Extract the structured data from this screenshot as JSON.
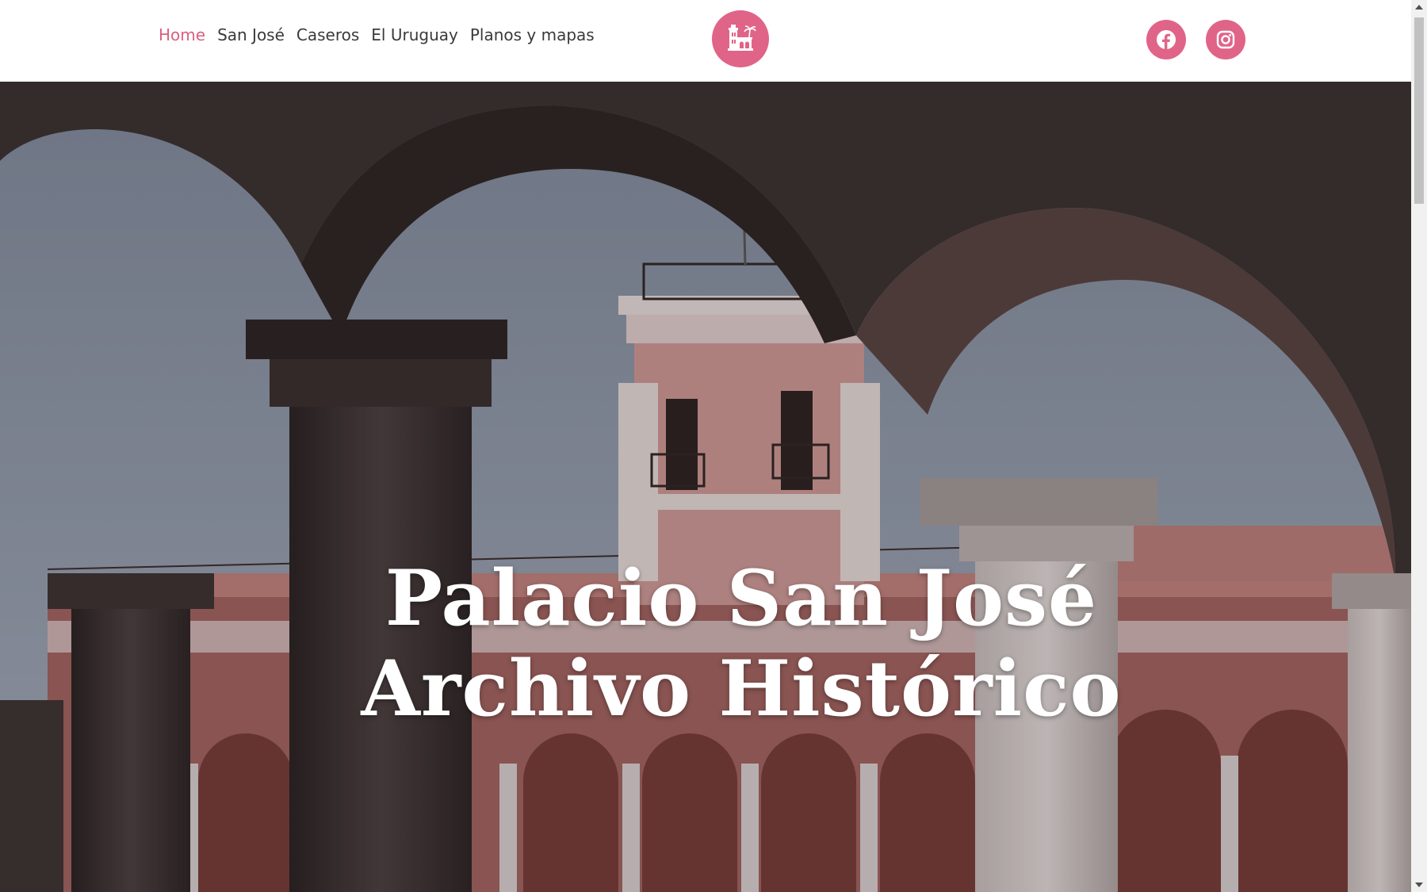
{
  "nav": {
    "items": [
      {
        "label": "Home",
        "active": true
      },
      {
        "label": "San José",
        "active": false
      },
      {
        "label": "Caseros",
        "active": false
      },
      {
        "label": "El Uruguay",
        "active": false
      },
      {
        "label": "Planos y mapas",
        "active": false
      }
    ]
  },
  "header": {
    "logo_icon": "palace-tower-logo-icon",
    "social": [
      {
        "icon": "facebook-icon"
      },
      {
        "icon": "instagram-icon"
      }
    ]
  },
  "hero": {
    "title_line1": "Palacio San José",
    "title_line2": "Archivo Histórico"
  },
  "colors": {
    "accent": "#e06488",
    "nav_active": "#d9607e",
    "nav_text": "#3a3a3a"
  }
}
